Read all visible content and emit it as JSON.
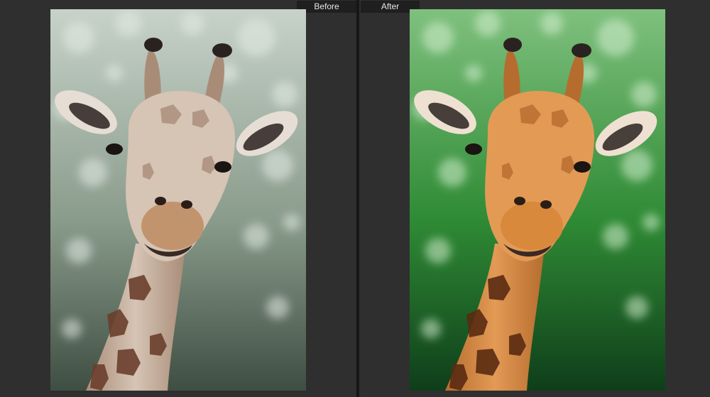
{
  "labels": {
    "before": "Before",
    "after": "After"
  },
  "palette": {
    "before": {
      "bg_top": "#c7d2c9",
      "bg_mid": "#8a9c8c",
      "bg_bottom": "#3f4e42",
      "bokeh": "#e6ece6",
      "skin": "#d6c4b4",
      "skin_dark": "#a98c78",
      "spot": "#6a3e2c",
      "muzzle": "#c2946e",
      "ear": "#e6ddd5"
    },
    "after": {
      "bg_top": "#7fc07e",
      "bg_mid": "#2f8b35",
      "bg_bottom": "#0f3e1a",
      "bokeh": "#d7f0d3",
      "skin": "#e39a55",
      "skin_dark": "#b66c2e",
      "spot": "#5a2a12",
      "muzzle": "#d8893b",
      "ear": "#efe1d1"
    }
  },
  "icons": {
    "photo": "giraffe-photo-icon"
  }
}
